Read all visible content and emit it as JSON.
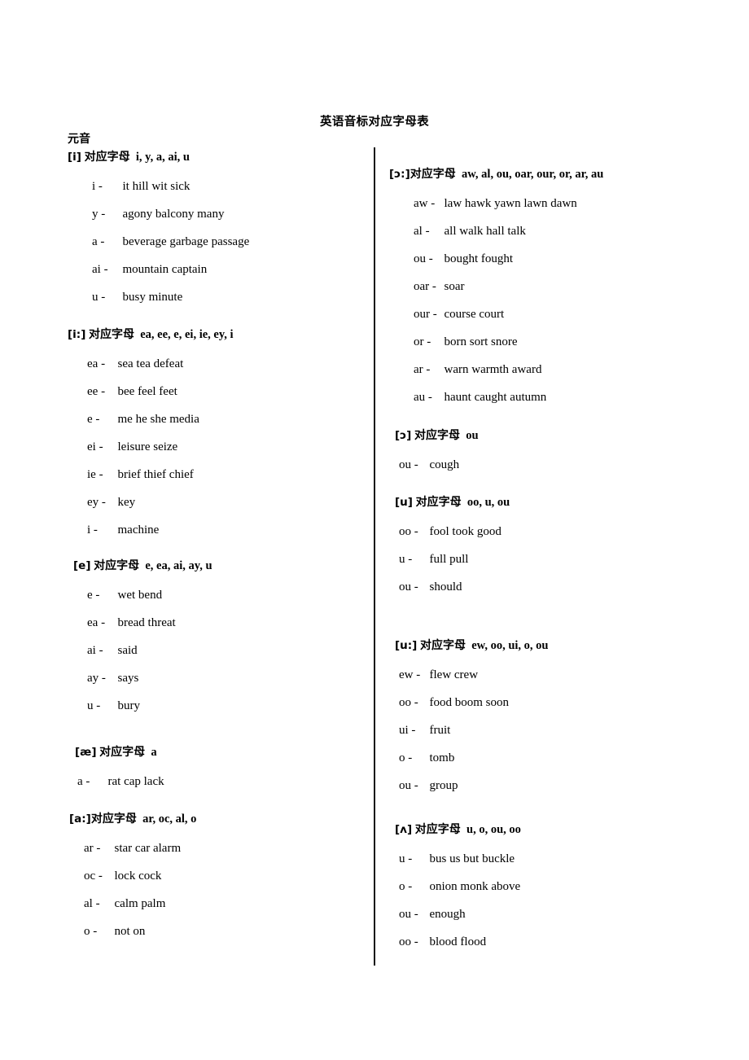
{
  "document": {
    "title": "英语音标对应字母表",
    "group_heading": "元音",
    "label_word": "对应字母"
  },
  "left_column": [
    {
      "ipa": "[i]",
      "label": "对应字母",
      "letters": "i, y, a, ai, u",
      "rows": [
        {
          "letter": "i -",
          "words": "it   hill   wit   sick"
        },
        {
          "letter": "y -",
          "words": "agony   balcony   many"
        },
        {
          "letter": "a -",
          "words": "beverage   garbage   passage"
        },
        {
          "letter": "ai -",
          "words": "mountain     captain"
        },
        {
          "letter": "u -",
          "words": "busy   minute"
        }
      ]
    },
    {
      "ipa": "[i:]",
      "label": "对应字母",
      "letters": "ea, ee, e, ei, ie, ey, i",
      "rows": [
        {
          "letter": "ea -",
          "words": "sea   tea   defeat"
        },
        {
          "letter": "ee -",
          "words": "bee   feel   feet"
        },
        {
          "letter": "e -",
          "words": "me he she media"
        },
        {
          "letter": "ei -",
          "words": "leisure     seize"
        },
        {
          "letter": "ie -",
          "words": "brief   thief   chief"
        },
        {
          "letter": "ey -",
          "words": "key"
        },
        {
          "letter": "i -",
          "words": "machine"
        }
      ]
    },
    {
      "ipa": "[e]",
      "label": "对应字母",
      "letters": "e, ea, ai, ay, u",
      "rows": [
        {
          "letter": "e -",
          "words": "wet   bend"
        },
        {
          "letter": "ea -",
          "words": "bread threat"
        },
        {
          "letter": "ai -",
          "words": "said"
        },
        {
          "letter": "ay -",
          "words": "says"
        },
        {
          "letter": "u -",
          "words": "bury"
        }
      ]
    },
    {
      "ipa": "[æ]",
      "label": "对应字母",
      "letters": "a",
      "rows": [
        {
          "letter": "a -",
          "words": "rat   cap   lack"
        }
      ]
    },
    {
      "ipa": "[a:]",
      "label": "对应字母",
      "letters": "ar, oc, al, o",
      "rows": [
        {
          "letter": "ar -",
          "words": "star   car   alarm"
        },
        {
          "letter": "oc -",
          "words": "lock   cock"
        },
        {
          "letter": "al -",
          "words": "calm   palm"
        },
        {
          "letter": "o -",
          "words": "not   on"
        }
      ]
    }
  ],
  "right_column": [
    {
      "ipa": "[ɔ:]",
      "label": "对应字母",
      "letters": "aw, al, ou, oar, our, or, ar, au",
      "rows": [
        {
          "letter": "aw -",
          "words": "law   hawk   yawn   lawn   dawn"
        },
        {
          "letter": "al -",
          "words": "all   walk    hall   talk"
        },
        {
          "letter": "ou -",
          "words": "bought   fought"
        },
        {
          "letter": "oar -",
          "words": "soar"
        },
        {
          "letter": "our -",
          "words": "course   court"
        },
        {
          "letter": "or -",
          "words": "born   sort   snore"
        },
        {
          "letter": "ar -",
          "words": "warn    warmth   award"
        },
        {
          "letter": "au -",
          "words": "haunt   caught   autumn"
        }
      ]
    },
    {
      "ipa": "[ɔ]",
      "label": "对应字母",
      "letters": "ou",
      "rows": [
        {
          "letter": "ou -",
          "words": "cough"
        }
      ]
    },
    {
      "ipa": "[u]",
      "label": "对应字母",
      "letters": "oo, u, ou",
      "rows": [
        {
          "letter": "oo -",
          "words": "fool   took   good"
        },
        {
          "letter": "u -",
          "words": "full   pull"
        },
        {
          "letter": "ou -",
          "words": "should"
        }
      ]
    },
    {
      "ipa": "[u:]",
      "label": "对应字母",
      "letters": "ew, oo, ui, o, ou",
      "rows": [
        {
          "letter": "ew -",
          "words": "flew   crew"
        },
        {
          "letter": "oo -",
          "words": "food   boom   soon"
        },
        {
          "letter": "ui  -",
          "words": "fruit"
        },
        {
          "letter": "o -",
          "words": "tomb"
        },
        {
          "letter": "ou -",
          "words": "group"
        }
      ]
    },
    {
      "ipa": "[ʌ]",
      "label": "对应字母",
      "letters": "u, o, ou, oo",
      "rows": [
        {
          "letter": "u -",
          "words": "bus   us   but   buckle"
        },
        {
          "letter": "o -",
          "words": "onion   monk above"
        },
        {
          "letter": "ou -",
          "words": "enough"
        },
        {
          "letter": "oo -",
          "words": "blood   flood"
        }
      ]
    }
  ]
}
